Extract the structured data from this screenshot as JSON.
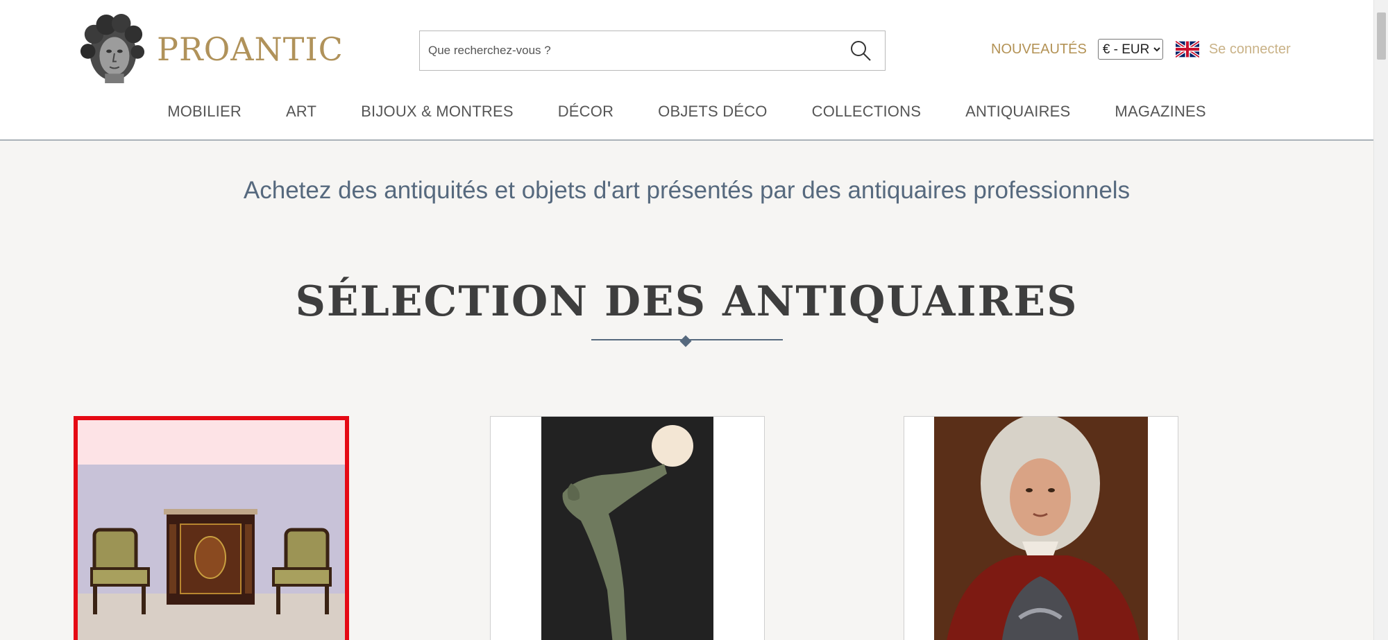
{
  "header": {
    "brand": "PROANTIC",
    "logo_icon": "classical-head-sculpture-icon",
    "search": {
      "placeholder": "Que recherchez-vous ?",
      "value": "",
      "icon": "search-icon"
    },
    "nouveautes_label": "NOUVEAUTÉS",
    "currency": {
      "selected": "€ - EUR",
      "options": [
        "€ - EUR"
      ]
    },
    "language_flag_icon": "uk-flag-icon",
    "login_label": "Se connecter"
  },
  "nav": {
    "items": [
      {
        "label": "MOBILIER"
      },
      {
        "label": "ART"
      },
      {
        "label": "BIJOUX & MONTRES"
      },
      {
        "label": "DÉCOR"
      },
      {
        "label": "OBJETS DÉCO"
      },
      {
        "label": "COLLECTIONS"
      },
      {
        "label": "ANTIQUAIRES"
      },
      {
        "label": "MAGAZINES"
      }
    ]
  },
  "main": {
    "tagline": "Achetez des antiquités et objets d'art présentés par des antiquaires professionnels",
    "section_title": "SÉLECTION DES ANTIQUAIRES",
    "cards": [
      {
        "image": "furniture-set-cabinet-armchairs-photo",
        "selected": true
      },
      {
        "image": "art-deco-bronze-dancer-lamp-photo",
        "selected": false
      },
      {
        "image": "portrait-nobleman-armor-painting-photo",
        "selected": false
      }
    ]
  },
  "colors": {
    "brand_gold": "#b0925a",
    "tagline_blue": "#56697e",
    "selection_red": "#e50914",
    "background": "#f6f5f3"
  }
}
